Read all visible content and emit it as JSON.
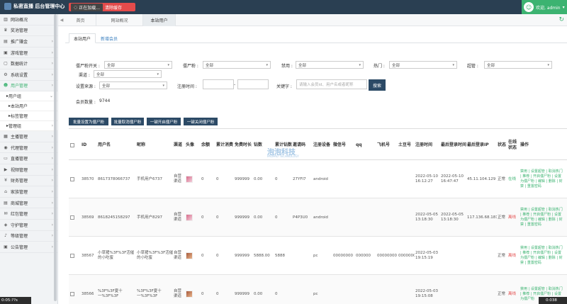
{
  "header": {
    "title": "私密直播 后台管理中心",
    "loading": "正在加载...",
    "clear": "清除缓存",
    "user": "欢迎, admin"
  },
  "sidebar": [
    {
      "label": "网站概况",
      "icon": "chart-icon",
      "glyph": "▥",
      "chev": false
    },
    {
      "label": "奖池管理",
      "icon": "trophy-icon",
      "glyph": "♛",
      "chev": false
    },
    {
      "label": "推广赚金",
      "icon": "promo-icon",
      "glyph": "▤",
      "chev": true
    },
    {
      "label": "游戏管理",
      "icon": "game-icon",
      "glyph": "▣",
      "chev": true
    },
    {
      "label": "数据统计",
      "icon": "stats-icon",
      "glyph": "▢",
      "chev": true
    },
    {
      "label": "系统设置",
      "icon": "gear-icon",
      "glyph": "⚙",
      "chev": true
    },
    {
      "label": "用户管理",
      "icon": "users-icon",
      "glyph": "☻",
      "chev": true,
      "active": true
    }
  ],
  "sidebar_sub": {
    "group": "用户组",
    "items": [
      "本站用户",
      "标签管理"
    ],
    "admin_group": "管理组"
  },
  "sidebar_bottom": [
    {
      "label": "主播管理",
      "icon": "anchor-icon",
      "glyph": "▦"
    },
    {
      "label": "代理管理",
      "icon": "eye-icon",
      "glyph": "◉"
    },
    {
      "label": "直播管理",
      "icon": "live-icon",
      "glyph": "▭"
    },
    {
      "label": "视频管理",
      "icon": "video-icon",
      "glyph": "▶"
    },
    {
      "label": "财务管理",
      "icon": "finance-icon",
      "glyph": "¥"
    },
    {
      "label": "家族管理",
      "icon": "family-icon",
      "glyph": "⌂"
    },
    {
      "label": "商城管理",
      "icon": "shop-icon",
      "glyph": "▤"
    },
    {
      "label": "红包管理",
      "icon": "redpack-icon",
      "glyph": "✉"
    },
    {
      "label": "守护管理",
      "icon": "guard-icon",
      "glyph": "◈"
    },
    {
      "label": "等级管理",
      "icon": "level-icon",
      "glyph": "♪"
    },
    {
      "label": "公告管理",
      "icon": "notice-icon",
      "glyph": "▣"
    }
  ],
  "page_tabs": [
    "首页",
    "网站概况",
    "本站用户"
  ],
  "subtabs": {
    "active": "本站用户",
    "other": "新增会员"
  },
  "filters": {
    "zombie_switch": "僵尸粉开关 :",
    "zombie": "僵尸粉 :",
    "banned": "禁用 :",
    "hot": "热门 :",
    "super": "超管 :",
    "channel": "渠道 :",
    "source": "设置来源 :",
    "reg_time": "注册时间 :",
    "keyword": "关键字 :",
    "all": "全部",
    "keyword_placeholder": "请输入会员id、用户名或者昵称",
    "search": "搜索",
    "count_label": "会员数量 :",
    "count": "9744"
  },
  "actions": [
    "批量设置为僵尸粉",
    "批量取消僵尸粉",
    "一键开启僵尸粉",
    "一键关闭僵尸粉"
  ],
  "table": {
    "headers": [
      "ID",
      "用户名",
      "昵称",
      "渠道",
      "头像",
      "余额",
      "累计消费",
      "免费时长",
      "钻数",
      "累计钻数",
      "邀请码",
      "注册设备",
      "微信号",
      "qq",
      "飞机号",
      "土豆号",
      "注册时间",
      "最后登录时间",
      "最后登录IP",
      "状态",
      "在线状态",
      "操作"
    ],
    "rows": [
      {
        "id": "38570",
        "user": "8617378066737",
        "nick": "手机用户6737",
        "channel": "自营渠道",
        "balance": "0",
        "spent": "0",
        "free": "999999",
        "coins": "0.00",
        "total": "0",
        "invite": "27YFI7",
        "device": "android",
        "wx": "",
        "qq": "",
        "tg": "",
        "td": "",
        "reg": "2022-05-10 16:12:27",
        "last": "2022-05-10 16:47:47",
        "ip": "45.11.104.129",
        "status": "正常",
        "online": "在线"
      },
      {
        "id": "38569",
        "user": "8618245158297",
        "nick": "手机用户8297",
        "channel": "自营渠道",
        "balance": "0",
        "spent": "0",
        "free": "999999",
        "coins": "0.00",
        "total": "0",
        "invite": "P4P3U0",
        "device": "android",
        "wx": "",
        "qq": "",
        "tg": "",
        "td": "",
        "reg": "2022-05-05 13:18:30",
        "last": "2022-05-05 13:18:30",
        "ip": "117.136.68.181",
        "status": "正常",
        "online": "离线"
      },
      {
        "id": "38567",
        "user": "小草猪%3F%3F活催的小吃蜜",
        "nick": "小草猪%3F%3F活催的小吃蜜",
        "channel": "自营渠道",
        "balance": "0",
        "spent": "0",
        "free": "999999",
        "coins": "5888.00",
        "total": "5888",
        "invite": "",
        "device": "pc",
        "wx": "00000000",
        "qq": "000000",
        "tg": "00000000",
        "td": "00000000",
        "reg": "2022-05-03 19:15:19",
        "last": "",
        "ip": "",
        "status": "正常",
        "online": "离线"
      },
      {
        "id": "38566",
        "user": "%3F%3F夏十一%3F%3F",
        "nick": "%3F%3F夏十一%3F%3F",
        "channel": "自营渠道",
        "balance": "0",
        "spent": "0",
        "free": "999999",
        "coins": "0.00",
        "total": "0",
        "invite": "",
        "device": "pc",
        "wx": "",
        "qq": "",
        "tg": "",
        "td": "",
        "reg": "2022-05-03 19:15:08",
        "last": "",
        "ip": "",
        "status": "正常",
        "online": "离线"
      }
    ],
    "ops_text": [
      "禁用 | 设置超管 | 取消热门 | 推荐 | 开启僵尸粉 | 设置为僵尸粉 | 编辑 | 删除 | 封禁 | 重置密码",
      "禁用 | 设置超管 | 取消热门 | 推荐 | 开启僵尸粉 | 设置为僵尸粉 | 编辑 | 删除 | 封禁 | 重置密码",
      "禁用 | 设置超管 | 取消热门 | 推荐 | 开启僵尸粉 | 设置为僵尸粉 | 编辑 | 删除 | 封禁 | 重置密码",
      "禁用 | 设置超管 | 取消热门 | 推荐 | 开启僵尸粉 | 设置为僵尸粉"
    ]
  },
  "watermark": {
    "text": "泡泡科技",
    "sub": "PAOPAO TECHNOLOGY"
  },
  "status_bar": {
    "left": "0:05:??s",
    "right": "0:038"
  },
  "colors": {
    "accent": "#3cb371",
    "header": "#2a3f52",
    "danger": "#e34b4b",
    "primary_btn": "#2c4a66"
  }
}
